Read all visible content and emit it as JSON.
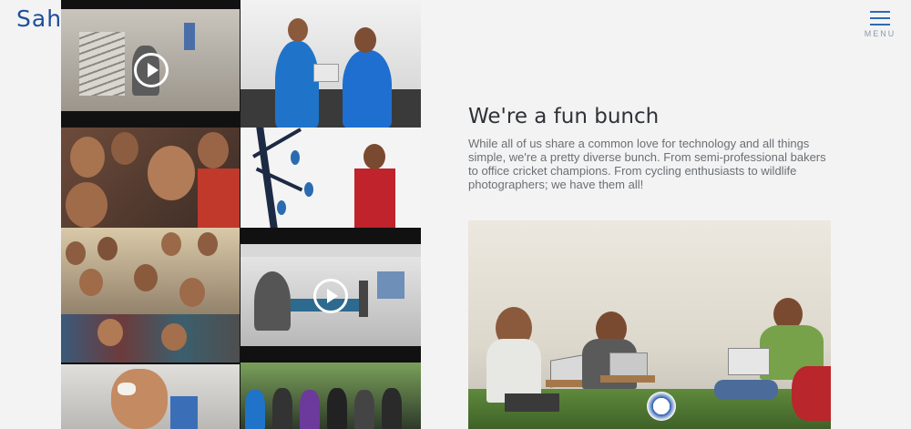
{
  "header": {
    "logo_text": "Sahaj",
    "menu_label": "MENU",
    "menu_icon": "hamburger-icon"
  },
  "gallery": {
    "play_icon": "play-icon",
    "photos": [
      {
        "type": "video"
      },
      {
        "type": "photo"
      },
      {
        "type": "photo"
      },
      {
        "type": "photo"
      },
      {
        "type": "photo"
      },
      {
        "type": "video"
      },
      {
        "type": "photo"
      },
      {
        "type": "photo"
      }
    ]
  },
  "section": {
    "title": "We're a fun bunch",
    "body": "While all of us share a common love for technology and all things simple, we're a pretty diverse bunch. From semi-professional bakers to office cricket champions. From cycling enthusiasts to wildlife photographers; we have them all!"
  },
  "colors": {
    "background": "#f3f3f4",
    "brand_blue": "#1d4f9a",
    "title": "#2f3236",
    "body_text": "#6b6f73"
  }
}
